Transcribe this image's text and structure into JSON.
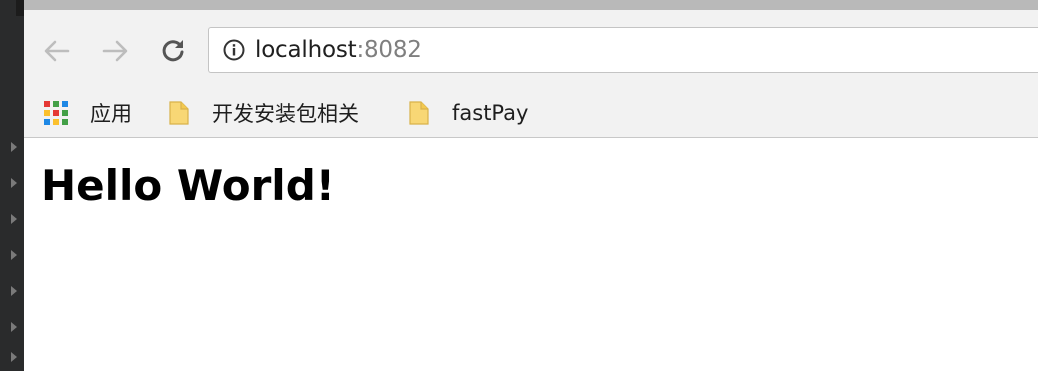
{
  "browser": {
    "address_bar": {
      "host": "localhost",
      "port": ":8082"
    }
  },
  "bookmarks": {
    "items": [
      {
        "label": "应用",
        "icon": "apps-grid-icon"
      },
      {
        "label": "开发安装包相关",
        "icon": "folder-icon"
      },
      {
        "label": "fastPay",
        "icon": "folder-icon"
      }
    ]
  },
  "page": {
    "heading": "Hello World!"
  },
  "colors": {
    "toolbar_bg": "#f2f2f2",
    "folder_yellow": "#f8d775",
    "apps_icon_colors": [
      "#e53935",
      "#43a047",
      "#1e88e5",
      "#fbc02d",
      "#e53935",
      "#43a047",
      "#1e88e5",
      "#fbc02d",
      "#43a047"
    ]
  }
}
